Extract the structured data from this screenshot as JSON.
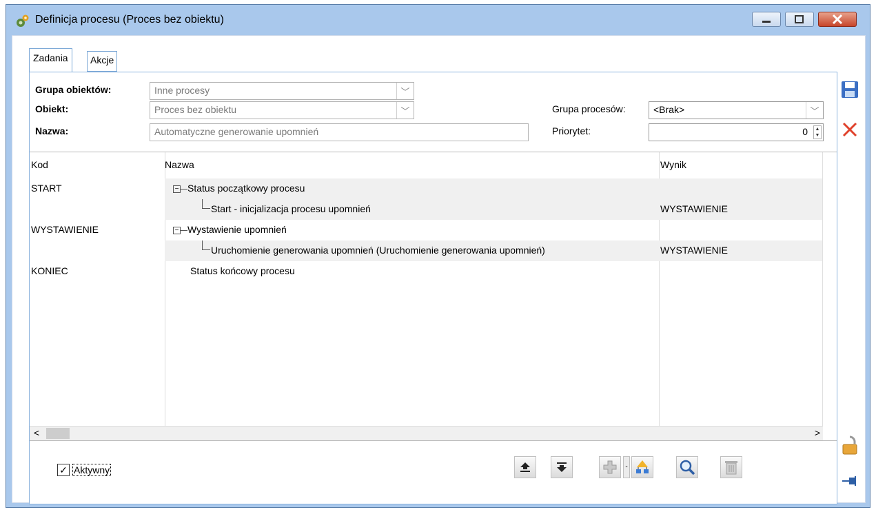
{
  "window": {
    "title": "Definicja procesu (Proces bez obiektu)"
  },
  "tabs": [
    {
      "label": "Zadania",
      "active": true
    },
    {
      "label": "Akcje",
      "active": false
    }
  ],
  "form": {
    "grupa_obiektow_label": "Grupa obiektów:",
    "grupa_obiektow_value": "Inne procesy",
    "obiekt_label": "Obiekt:",
    "obiekt_value": "Proces bez obiektu",
    "nazwa_label": "Nazwa:",
    "nazwa_value": "Automatyczne generowanie upomnień",
    "grupa_procesow_label": "Grupa procesów:",
    "grupa_procesow_value": "<Brak>",
    "priorytet_label": "Priorytet:",
    "priorytet_value": "0"
  },
  "grid": {
    "columns": [
      "Kod",
      "Nazwa",
      "Wynik"
    ],
    "rows": [
      {
        "kod": "START",
        "nazwa": "Status początkowy procesu",
        "wynik": "",
        "level": 0,
        "expanded": true
      },
      {
        "kod": "",
        "nazwa": "Start - inicjalizacja procesu upomnień",
        "wynik": "WYSTAWIENIE",
        "level": 1
      },
      {
        "kod": "WYSTAWIENIE",
        "nazwa": "Wystawienie upomnień",
        "wynik": "",
        "level": 0,
        "expanded": true
      },
      {
        "kod": "",
        "nazwa": "Uruchomienie generowania upomnień (Uruchomienie generowania upomnień)",
        "wynik": "WYSTAWIENIE",
        "level": 1
      },
      {
        "kod": "KONIEC",
        "nazwa": "Status końcowy procesu",
        "wynik": "",
        "level": 0
      }
    ],
    "scroll_left": "<",
    "scroll_right": ">"
  },
  "footer": {
    "aktywny_label": "Aktywny",
    "aktywny_checked": true,
    "checkmark": "✓"
  },
  "icons": {
    "move_up": "move-up-icon",
    "move_down": "move-down-icon",
    "add": "add-icon",
    "tree": "tree-icon",
    "search": "search-icon",
    "delete": "trash-icon",
    "save": "save-icon",
    "close": "close-icon",
    "lock": "lock-icon",
    "pin": "pin-icon"
  },
  "colors": {
    "window_frame": "#a9c8ec",
    "close_red": "#e0422c",
    "tab_border": "#7aa7d6",
    "save_blue": "#3b6fc4"
  }
}
